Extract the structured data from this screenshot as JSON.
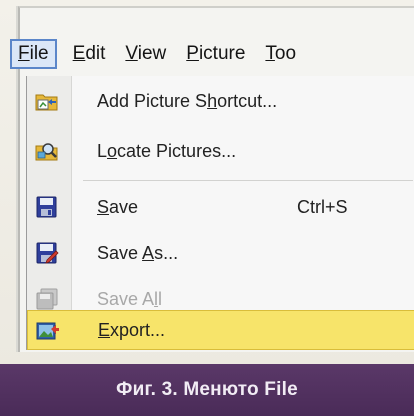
{
  "menubar": {
    "items": [
      {
        "prefix": "",
        "mnemonic": "F",
        "rest": "ile"
      },
      {
        "prefix": "",
        "mnemonic": "E",
        "rest": "dit"
      },
      {
        "prefix": "",
        "mnemonic": "V",
        "rest": "iew"
      },
      {
        "prefix": "",
        "mnemonic": "P",
        "rest": "icture"
      },
      {
        "prefix": "",
        "mnemonic": "T",
        "rest": "oo"
      }
    ]
  },
  "file_menu": {
    "items": [
      {
        "before": "Add Picture S",
        "mnemonic": "h",
        "after": "ortcut...",
        "shortcut": "",
        "icon": "add-shortcut-icon"
      },
      {
        "before": "L",
        "mnemonic": "o",
        "after": "cate Pictures...",
        "shortcut": "",
        "icon": "locate-pictures-icon"
      },
      {
        "before": "",
        "mnemonic": "S",
        "after": "ave",
        "shortcut": "Ctrl+S",
        "icon": "save-icon"
      },
      {
        "before": "Save ",
        "mnemonic": "A",
        "after": "s...",
        "shortcut": "",
        "icon": "save-as-icon"
      },
      {
        "before": "Save A",
        "mnemonic": "l",
        "after": "l",
        "shortcut": "",
        "icon": "save-all-icon"
      },
      {
        "before": "",
        "mnemonic": "E",
        "after": "xport...",
        "shortcut": "",
        "icon": "export-icon"
      }
    ]
  },
  "caption": {
    "text": "Фиг. 3. Менюто File"
  },
  "colors": {
    "highlight": "#f7e46a",
    "caption_bg": "#4a2b58",
    "menubar_active_border": "#5b86c9"
  }
}
